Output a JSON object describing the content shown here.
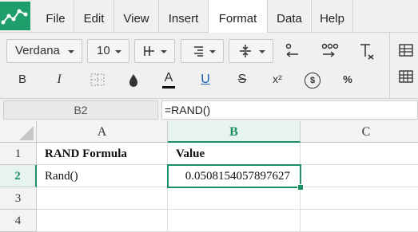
{
  "menu": [
    "File",
    "Edit",
    "View",
    "Insert",
    "Format",
    "Data",
    "Help"
  ],
  "active_menu": "Format",
  "toolbar": {
    "font_family": "Verdana",
    "font_size": "10",
    "bold_label": "B",
    "italic_label": "I",
    "text_color_label": "A",
    "underline_label": "U",
    "strike_label": "S",
    "superscript_label": "x²",
    "currency_label": "$",
    "percent_label": "%"
  },
  "formula_bar": {
    "cell_ref": "B2",
    "formula": "=RAND()"
  },
  "columns": [
    "A",
    "B",
    "C"
  ],
  "rows": [
    "1",
    "2",
    "3",
    "4"
  ],
  "cells": {
    "a1": "RAND Formula",
    "b1": "Value",
    "a2": "Rand()",
    "b2": "0.0508154057897627"
  },
  "colors": {
    "accent": "#1a8f5f",
    "brand": "#1e9e6a",
    "toolbar_bg": "#f0f0f0"
  }
}
